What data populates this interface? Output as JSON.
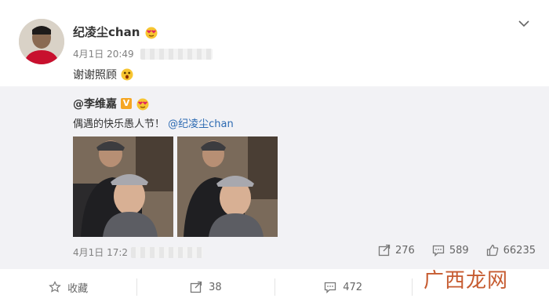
{
  "post": {
    "username": "纪凌尘chan",
    "timestamp": "4月1日 20:49",
    "text": "谢谢照顾",
    "emoji_after_name": "heart-eyes-emoji",
    "emoji_after_text": "shocked-emoji"
  },
  "repost": {
    "username": "@李维嘉",
    "verified_badge": "V",
    "text": "偶遇的快乐愚人节！",
    "mention": "@纪凌尘chan",
    "timestamp": "4月1日 17:2",
    "stats": {
      "reposts": "276",
      "comments": "589",
      "likes": "66235"
    }
  },
  "actions": {
    "favorite_label": "收藏",
    "repost_count": "38",
    "comment_count": "472",
    "like_count": ""
  },
  "watermark": "广西龙网",
  "colors": {
    "link": "#2c6ab2",
    "repost_bg": "#f2f2f5",
    "badge": "#f5a623",
    "watermark": "#c04a1a"
  }
}
